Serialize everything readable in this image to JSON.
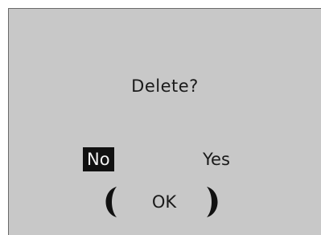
{
  "dialog": {
    "prompt": "Delete?",
    "options": {
      "no_label": "No",
      "yes_label": "Yes",
      "selected": "No"
    },
    "confirm_label": "OK"
  },
  "colors": {
    "background": "#c8c8c8",
    "text": "#1a1a1a",
    "highlight_bg": "#111111",
    "highlight_text": "#f2f2f2"
  },
  "icons": {
    "left": "left-crescent-arrow-icon",
    "right": "right-crescent-arrow-icon"
  }
}
